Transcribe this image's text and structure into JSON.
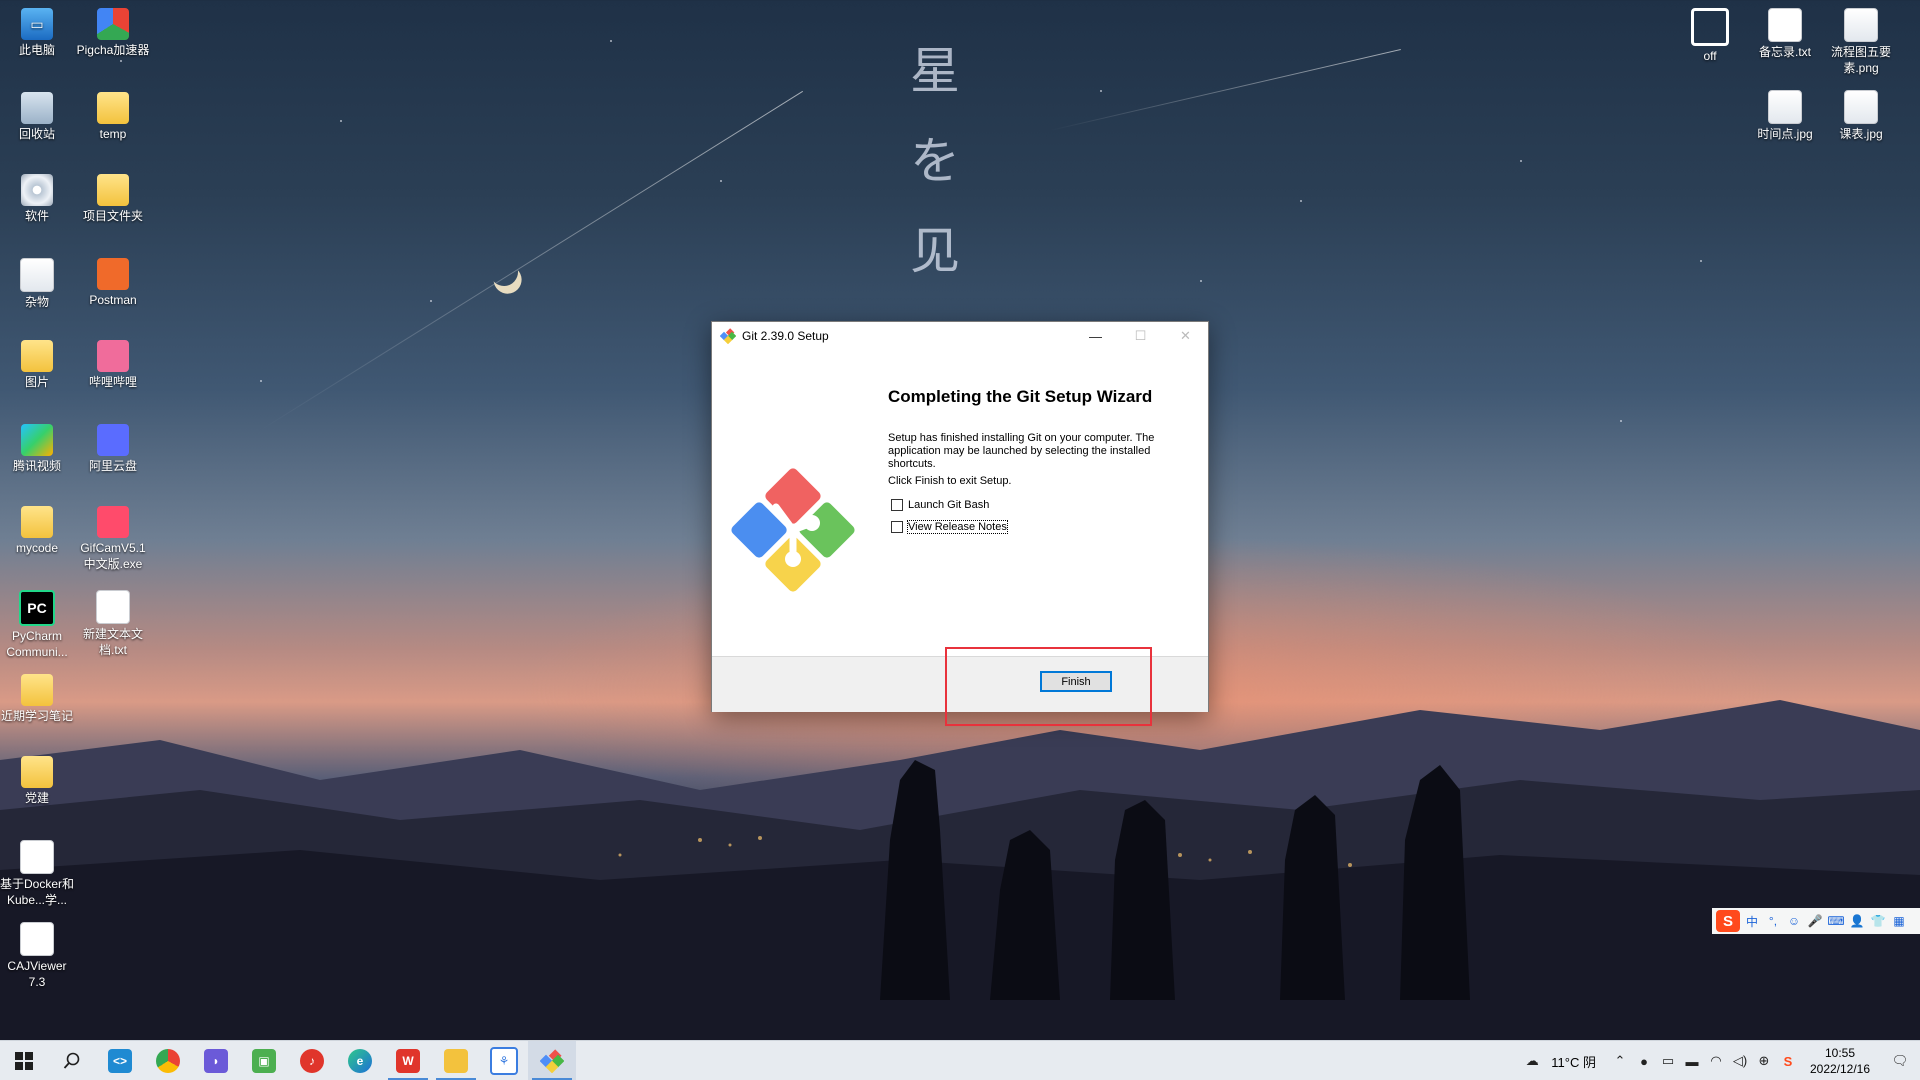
{
  "desktop": {
    "left_icons": [
      {
        "label": "此电脑",
        "icon": "computer-icon"
      },
      {
        "label": "Pigcha加速器",
        "icon": "pigcha-icon"
      },
      {
        "label": "回收站",
        "icon": "recycle-bin-icon"
      },
      {
        "label": "temp",
        "icon": "folder-icon"
      },
      {
        "label": "软件",
        "icon": "dvd-drive-icon"
      },
      {
        "label": "项目文件夹",
        "icon": "folder-icon"
      },
      {
        "label": "杂物",
        "icon": "drive-icon"
      },
      {
        "label": "Postman",
        "icon": "postman-icon"
      },
      {
        "label": "图片",
        "icon": "folder-icon"
      },
      {
        "label": "哔哩哔哩",
        "icon": "bilibili-icon"
      },
      {
        "label": "腾讯视频",
        "icon": "tencent-video-icon"
      },
      {
        "label": "阿里云盘",
        "icon": "aliyun-drive-icon"
      },
      {
        "label": "mycode",
        "icon": "folder-icon"
      },
      {
        "label": "GifCamV5.1中文版.exe",
        "icon": "gifcam-icon"
      },
      {
        "label": "PyCharm Communi...",
        "icon": "pycharm-icon"
      },
      {
        "label": "新建文本文档.txt",
        "icon": "text-file-icon"
      },
      {
        "label": "近期学习笔记",
        "icon": "folder-icon"
      },
      {
        "label": "党建",
        "icon": "folder-icon"
      },
      {
        "label": "基于Docker和Kube...学...",
        "icon": "document-icon"
      },
      {
        "label": "CAJViewer 7.3",
        "icon": "document-icon"
      }
    ],
    "right_icons": [
      {
        "label": "off",
        "icon": "power-icon"
      },
      {
        "label": "备忘录.txt",
        "icon": "text-file-icon"
      },
      {
        "label": "流程图五要素.png",
        "icon": "image-file-icon"
      },
      {
        "label": "时间点.jpg",
        "icon": "image-file-icon"
      },
      {
        "label": "课表.jpg",
        "icon": "image-file-icon"
      }
    ],
    "wallpaper_text": [
      "星",
      "を",
      "见"
    ]
  },
  "dialog": {
    "title": "Git 2.39.0 Setup",
    "minimize_symbol": "—",
    "maximize_symbol": "☐",
    "close_symbol": "✕",
    "heading": "Completing the Git Setup Wizard",
    "paragraph1": "Setup has finished installing Git on your computer. The application may be launched by selecting the installed shortcuts.",
    "paragraph2": "Click Finish to exit Setup.",
    "checkbox1": {
      "label": "Launch Git Bash",
      "checked": false
    },
    "checkbox2": {
      "label": "View Release Notes",
      "checked": false
    },
    "finish_button": "Finish"
  },
  "ime": {
    "brand": "S",
    "items": [
      "中",
      "°,",
      "☺",
      "🎤",
      "⌨",
      "👤",
      "👕",
      "▦"
    ]
  },
  "taskbar": {
    "apps": [
      {
        "name": "start",
        "icon": "windows-icon"
      },
      {
        "name": "search",
        "icon": "search-icon"
      },
      {
        "name": "vscode",
        "icon": "vscode-icon"
      },
      {
        "name": "chrome",
        "icon": "chrome-icon"
      },
      {
        "name": "app",
        "icon": "app-icon"
      },
      {
        "name": "android",
        "icon": "android-icon"
      },
      {
        "name": "netease-music",
        "icon": "music-icon"
      },
      {
        "name": "edge",
        "icon": "edge-icon"
      },
      {
        "name": "wps",
        "icon": "wps-icon"
      },
      {
        "name": "file-explorer",
        "icon": "folder-icon"
      },
      {
        "name": "network",
        "icon": "network-icon"
      },
      {
        "name": "git-setup",
        "icon": "git-icon"
      }
    ],
    "weather": "11°C 阴",
    "time": "10:55",
    "date": "2022/12/16",
    "colors": {
      "taskbar_bg": "#e7ebf0",
      "accent": "#0078d7",
      "highlight": "#e8323c"
    }
  }
}
